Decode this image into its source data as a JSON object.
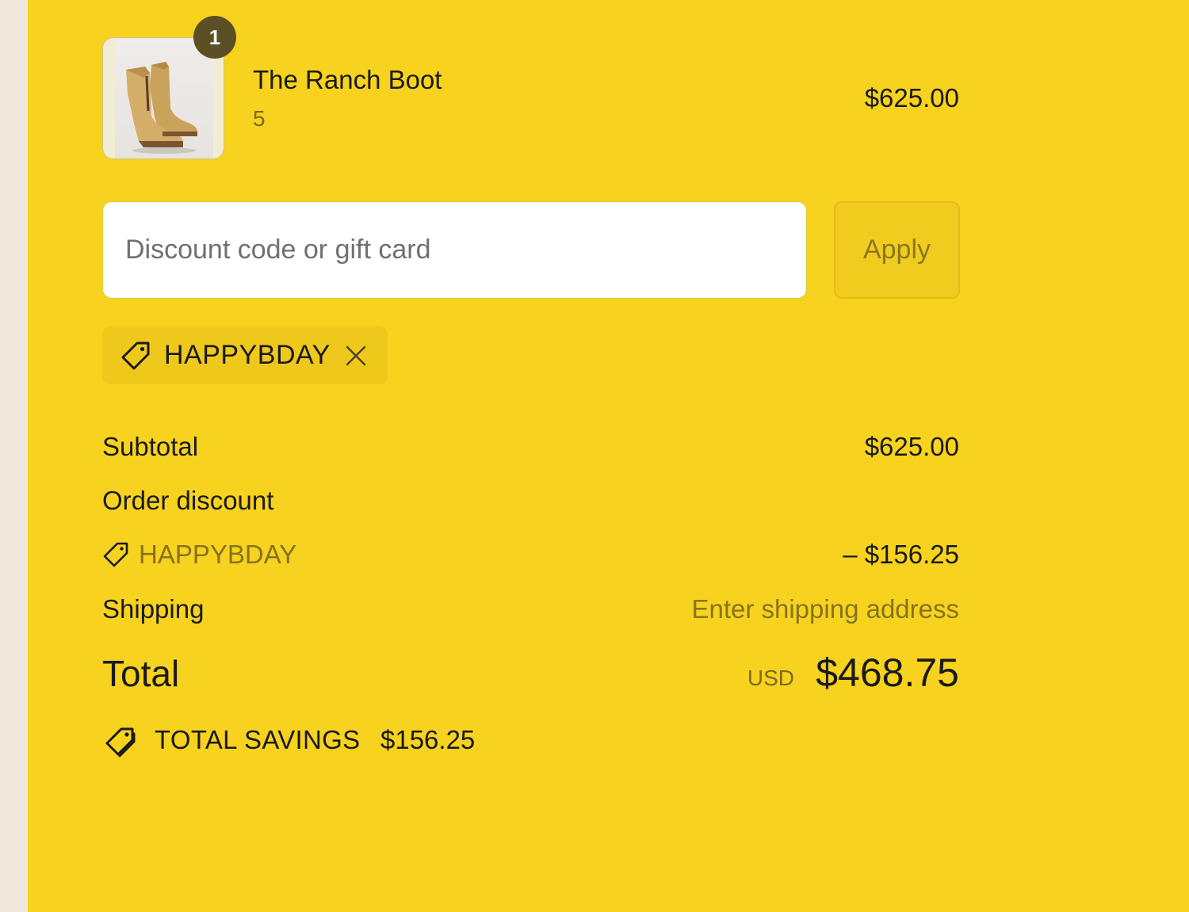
{
  "cart_item": {
    "name": "The Ranch Boot",
    "variant": "5",
    "price": "$625.00",
    "quantity": "1",
    "image": "boot-product-image"
  },
  "discount": {
    "placeholder": "Discount code or gift card",
    "apply_label": "Apply",
    "applied_code": "HAPPYBDAY"
  },
  "summary": {
    "subtotal_label": "Subtotal",
    "subtotal_value": "$625.00",
    "order_discount_label": "Order discount",
    "discount_code": "HAPPYBDAY",
    "discount_value": "– $156.25",
    "shipping_label": "Shipping",
    "shipping_value": "Enter shipping address",
    "total_label": "Total",
    "total_currency": "USD",
    "total_value": "$468.75",
    "savings_label": "TOTAL SAVINGS",
    "savings_value": "$156.25"
  },
  "colors": {
    "panel_bg": "#f7d21e",
    "left_strip": "#f0e8dc",
    "badge_bg": "#5b4f25",
    "muted_text": "#85741e"
  }
}
